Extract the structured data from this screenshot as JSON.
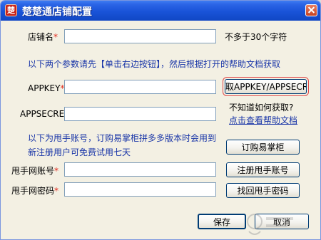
{
  "window": {
    "title": "楚楚通店铺配置",
    "app_icon_glyph": "楚",
    "close_icon": "close-icon"
  },
  "form": {
    "shop_name_label": "店铺名",
    "shop_name_value": "",
    "shop_name_hint": "不多于30个字符",
    "instruction_1": "以下两个参数请先【单击右边按钮】，然后根据打开的帮助文档获取",
    "appkey_label": "APPKEY",
    "appkey_value": "",
    "get_appkey_button": "取APPKEY/APPSECRET",
    "appsecret_label": "APPSECRET",
    "appsecret_value": "",
    "dont_know_text": "不知道如何获取?",
    "help_link": "点击查看帮助文档",
    "instruction_2_line1": "以下为甩手账号，订购易掌柜拼多多版本时会用到",
    "instruction_2_line2": "新注册用户可免费试用七天",
    "order_button": "订购易掌柜",
    "account_label": "甩手网账号",
    "account_value": "",
    "register_button": "注册甩手账号",
    "password_label": "甩手网密码",
    "password_value": "",
    "recover_button": "找回甩手密码",
    "required_mark": "*"
  },
  "footer": {
    "save_button": "保存",
    "cancel_button": "取消"
  },
  "colors": {
    "titlebar": "#1953d8",
    "required": "#e12b1e",
    "info_text": "#1a36a8",
    "highlight_border": "#e04848"
  }
}
